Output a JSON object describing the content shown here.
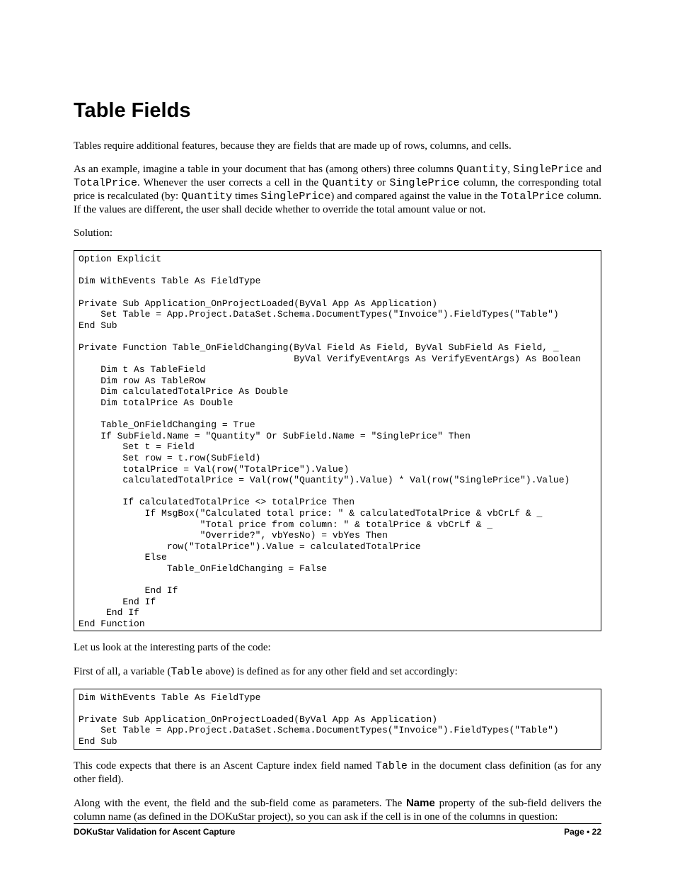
{
  "heading": "Table Fields",
  "p1": "Tables require additional features, because they are fields that are made up of rows, columns, and cells.",
  "p2a": "As  an  example,  imagine  a  table  in  your  document  that  has  (among  others)  three  columns ",
  "p2_quantity": "Quantity",
  "p2b": ", ",
  "p2_singleprice": "SinglePrice",
  "p2c": " and ",
  "p2_totalprice": "TotalPrice",
  "p2d": ". Whenever the user corrects a cell in the ",
  "p2_quantity2": "Quantity",
  "p2e": " or ",
  "p2_singleprice2": "SinglePrice",
  "p2f": " column, the corresponding total price is recalculated (by:  ",
  "p2_quantity3": "Quantity",
  "p2g": " times ",
  "p2_singleprice3": "SinglePrice",
  "p2h": ") and compared against the value in the ",
  "p2_totalprice2": "TotalPrice",
  "p2i": " column. If the values are different, the user shall decide whether to override the total amount value or not.",
  "p3": "Solution:",
  "code1": "Option Explicit\n\nDim WithEvents Table As FieldType\n\nPrivate Sub Application_OnProjectLoaded(ByVal App As Application)\n    Set Table = App.Project.DataSet.Schema.DocumentTypes(\"Invoice\").FieldTypes(\"Table\")\nEnd Sub\n\nPrivate Function Table_OnFieldChanging(ByVal Field As Field, ByVal SubField As Field, _\n                                       ByVal VerifyEventArgs As VerifyEventArgs) As Boolean\n    Dim t As TableField\n    Dim row As TableRow\n    Dim calculatedTotalPrice As Double\n    Dim totalPrice As Double\n\n    Table_OnFieldChanging = True\n    If SubField.Name = \"Quantity\" Or SubField.Name = \"SinglePrice\" Then\n        Set t = Field\n        Set row = t.row(SubField)\n        totalPrice = Val(row(\"TotalPrice\").Value)\n        calculatedTotalPrice = Val(row(\"Quantity\").Value) * Val(row(\"SinglePrice\").Value)\n\n        If calculatedTotalPrice <> totalPrice Then\n            If MsgBox(\"Calculated total price: \" & calculatedTotalPrice & vbCrLf & _\n                      \"Total price from column: \" & totalPrice & vbCrLf & _\n                      \"Override?\", vbYesNo) = vbYes Then\n                row(\"TotalPrice\").Value = calculatedTotalPrice\n            Else\n                Table_OnFieldChanging = False\n\n            End If\n        End If\n     End If\nEnd Function",
  "p4": "Let us look at the interesting parts of the code:",
  "p5a": "First of all, a variable (",
  "p5_table": "Table",
  "p5b": " above) is defined as for any other field and set accordingly:",
  "code2": "Dim WithEvents Table As FieldType\n\nPrivate Sub Application_OnProjectLoaded(ByVal App As Application)\n    Set Table = App.Project.DataSet.Schema.DocumentTypes(\"Invoice\").FieldTypes(\"Table\")\nEnd Sub",
  "p6a": "This code expects that there is an Ascent Capture index field named ",
  "p6_table": "Table",
  "p6b": " in the document class definition (as for any other field).",
  "p7a": "Along with the event, the field and the sub-field come as parameters. The ",
  "p7_name": "Name",
  "p7b": " property of the sub-field delivers the column name (as defined in the DOKuStar project), so you can ask if the cell is in one of the columns in question:",
  "footer_left": "DOKuStar Validation for Ascent Capture",
  "footer_right_label": "Page",
  "footer_right_num": "22"
}
